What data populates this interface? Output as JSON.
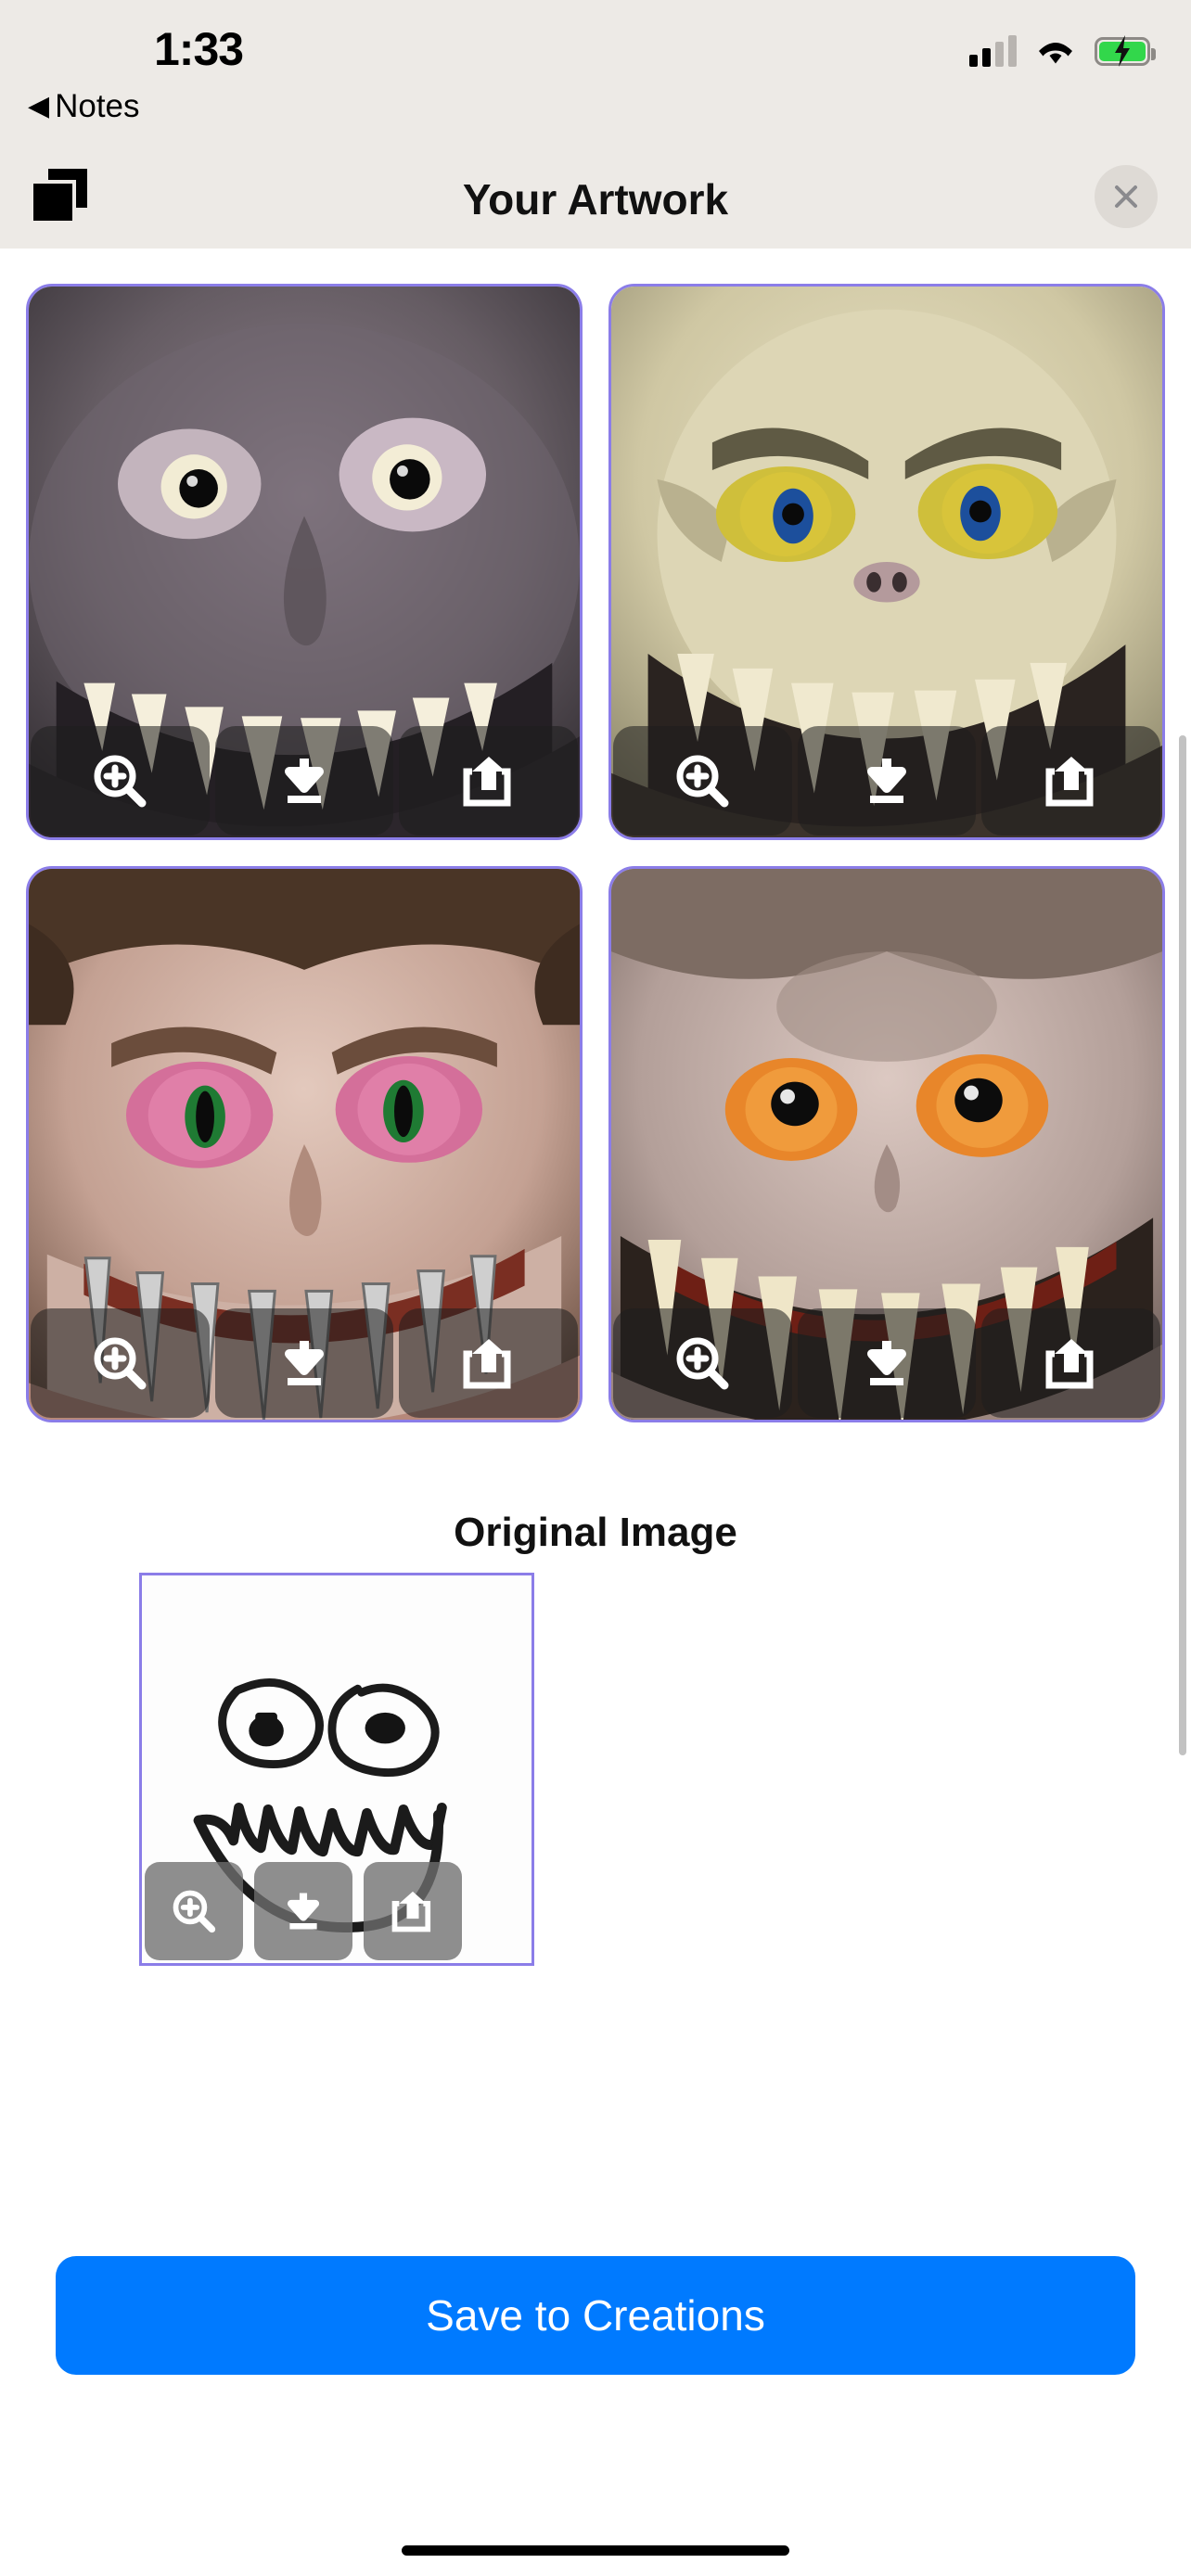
{
  "status_bar": {
    "time": "1:33",
    "back_label": "Notes",
    "back_caret": "◀",
    "signal_icon": "cellular-signal-icon",
    "wifi_icon": "wifi-icon",
    "battery_icon": "battery-charging-icon",
    "battery_color": "#32d74b"
  },
  "navbar": {
    "title": "Your Artwork",
    "copy_icon": "copy-stack-icon",
    "close_icon": "close-x-icon",
    "background": "#edeae6"
  },
  "theme": {
    "accent_border": "#8b7de8",
    "primary_button": "#007aff",
    "page_background": "#ffffff"
  },
  "actions": {
    "zoom_label": "zoom-in",
    "download_label": "download",
    "share_label": "share"
  },
  "artwork": {
    "tiles": [
      {
        "id": 1,
        "alt": "grey wrinkled monster face with yellow eyes and sharp white teeth"
      },
      {
        "id": 2,
        "alt": "pale bone-coloured monster face with blue and yellow eyes and fangs"
      },
      {
        "id": 3,
        "alt": "furry pink-eyed monster face with metallic sharp teeth"
      },
      {
        "id": 4,
        "alt": "scaly monster face with orange eyes and long cream fangs"
      }
    ]
  },
  "original": {
    "heading": "Original Image",
    "alt": "hand-drawn black marker sketch of two eyes and a zigzag toothy smile"
  },
  "footer": {
    "save_label": "Save to Creations"
  }
}
